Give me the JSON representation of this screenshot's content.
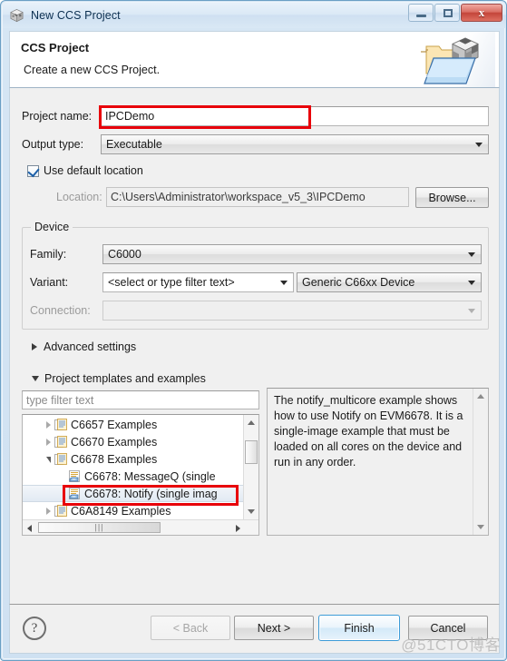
{
  "window": {
    "title": "New CCS Project",
    "icon": "cube-icon",
    "buttons": {
      "minimize": "minimize-icon",
      "maximize": "restore-icon",
      "close": "x"
    }
  },
  "header": {
    "title": "CCS Project",
    "subtitle": "Create a new CCS Project.",
    "image": "ccs-project-folder-icon"
  },
  "form": {
    "project_name_label": "Project name:",
    "project_name_value": "IPCDemo",
    "output_type_label": "Output type:",
    "output_type_value": "Executable",
    "use_default_location_label": "Use default location",
    "use_default_location_checked": true,
    "location_label": "Location:",
    "location_value": "C:\\Users\\Administrator\\workspace_v5_3\\IPCDemo",
    "browse_label": "Browse..."
  },
  "device": {
    "group_label": "Device",
    "family_label": "Family:",
    "family_value": "C6000",
    "variant_label": "Variant:",
    "variant_filter_value": "<select or type filter text>",
    "variant_device_value": "Generic C66xx Device",
    "connection_label": "Connection:",
    "connection_value": ""
  },
  "sections": {
    "advanced_settings_label": "Advanced settings",
    "advanced_settings_expanded": false,
    "templates_label": "Project templates and examples",
    "templates_expanded": true
  },
  "templates": {
    "filter_placeholder": "type filter text",
    "filter_value": "",
    "tree": [
      {
        "label": "C6657 Examples",
        "level": 0,
        "state": "collapsed",
        "icon": "examples-folder-icon",
        "selected": false
      },
      {
        "label": "C6670 Examples",
        "level": 0,
        "state": "collapsed",
        "icon": "examples-folder-icon",
        "selected": false
      },
      {
        "label": "C6678 Examples",
        "level": 0,
        "state": "expanded",
        "icon": "examples-folder-icon",
        "selected": false
      },
      {
        "label": "C6678: MessageQ (single",
        "level": 1,
        "state": "leaf",
        "icon": "example-item-icon",
        "selected": false
      },
      {
        "label": "C6678: Notify (single imag",
        "level": 1,
        "state": "leaf",
        "icon": "example-item-icon",
        "selected": true
      },
      {
        "label": "C6A8149 Examples",
        "level": 0,
        "state": "collapsed",
        "icon": "examples-folder-icon",
        "selected": false
      }
    ],
    "description": "The notify_multicore example shows how to use Notify on EVM6678. It is a single-image example that must be loaded on all cores on the device and run in any order."
  },
  "footer": {
    "help": "?",
    "back_label": "< Back",
    "back_enabled": false,
    "next_label": "Next >",
    "next_enabled": true,
    "finish_label": "Finish",
    "finish_default": true,
    "cancel_label": "Cancel"
  },
  "watermark": "@51CTO博客",
  "colors": {
    "annotation": "#e8000a",
    "title_text": "#0b2f50",
    "default_button_border": "#3c9bd8",
    "dialog_bg": "#f0f0f0"
  }
}
